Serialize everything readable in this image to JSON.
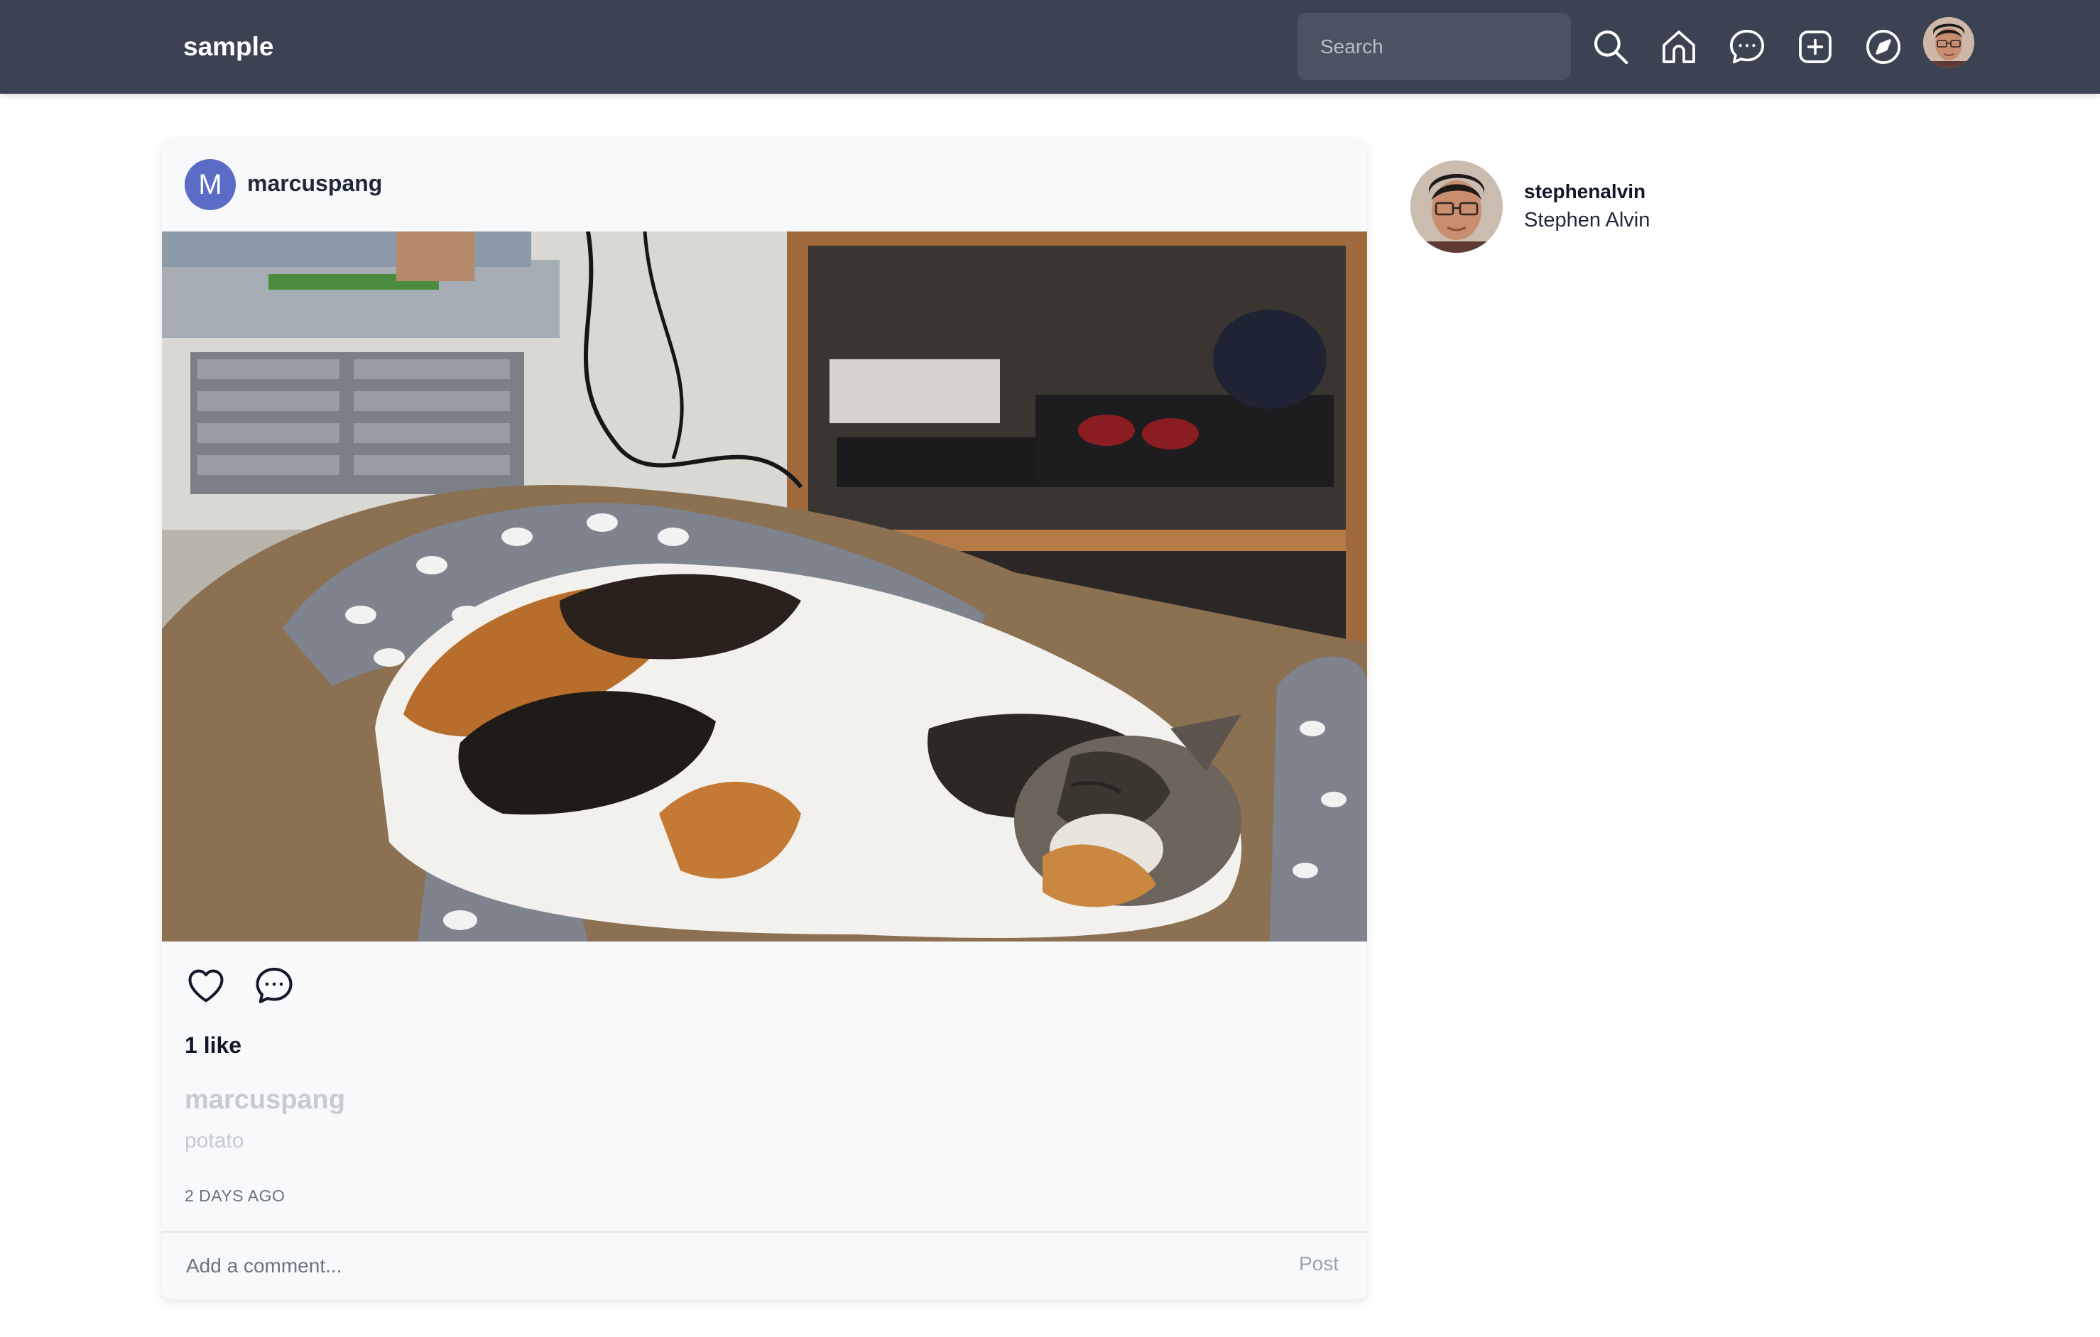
{
  "header": {
    "brand": "sample",
    "search_placeholder": "Search",
    "icons": [
      "search-icon",
      "home-icon",
      "messages-icon",
      "add-post-icon",
      "explore-icon",
      "avatar"
    ]
  },
  "post": {
    "author": {
      "initial": "M",
      "username": "marcuspang"
    },
    "image_description_icon": "photo",
    "actions": [
      "heart-icon",
      "comment-icon"
    ],
    "likes": "1 like",
    "caption": {
      "username": "marcuspang",
      "text": "potato"
    },
    "timestamp": "2 DAYS AGO",
    "comment_placeholder": "Add a comment...",
    "post_button": "Post"
  },
  "sidebar": {
    "username": "stephenalvin",
    "full_name": "Stephen Alvin"
  },
  "colors": {
    "navbar": "#3b4252",
    "card": "#f8f9fa",
    "avatar_accent": "#5b6cc6"
  }
}
